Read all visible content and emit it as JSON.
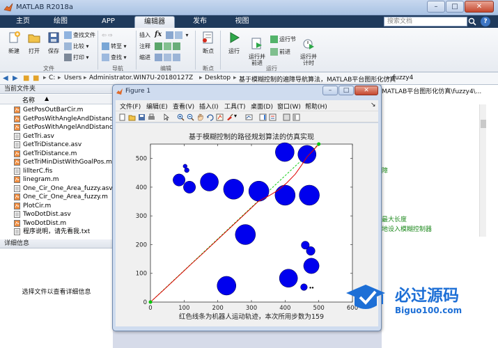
{
  "window": {
    "title": "MATLAB R2018a"
  },
  "tabs": [
    {
      "label": "主页",
      "active": false
    },
    {
      "label": "绘图",
      "active": false
    },
    {
      "label": "APP",
      "active": false
    },
    {
      "label": "编辑器",
      "active": true
    },
    {
      "label": "发布",
      "active": false
    },
    {
      "label": "视图",
      "active": false
    }
  ],
  "search": {
    "placeholder": "搜索文档"
  },
  "ribbon": {
    "file": {
      "new": "新建",
      "open": "打开",
      "save": "保存",
      "find_file": "查找文件",
      "compare": "比较",
      "print": "打印",
      "group": "文件"
    },
    "navigate": {
      "goto": "转至",
      "find": "查找",
      "group": "导航"
    },
    "edit": {
      "insert": "插入",
      "comment": "注释",
      "indent": "缩进",
      "fx": "fx",
      "group": "编辑"
    },
    "breakpoints": {
      "bp": "断点",
      "group": "断点"
    },
    "run": {
      "run": "运行",
      "run_advance": "运行并\n前进",
      "run_section": "运行节",
      "advance": "前进",
      "run_time": "运行并\n计时",
      "group": "运行"
    }
  },
  "address": {
    "crumbs": [
      "C:",
      "Users",
      "Administrator.WIN7U-20180127Z",
      "Desktop",
      "基于模糊控制的遍障导航算法，MATLAB平台图形化仿真",
      "fuzzy4"
    ]
  },
  "left_panel": {
    "header": "当前文件夹",
    "col_name": "名称",
    "files": [
      {
        "name": "GetPosOutBarCir.m",
        "type": "m"
      },
      {
        "name": "GetPosWithAngleAndDistance....",
        "type": "m"
      },
      {
        "name": "GetPosWithAngelAndDistance.m",
        "type": "m"
      },
      {
        "name": "GetTri.asv",
        "type": "asv"
      },
      {
        "name": "GetTriDistance.asv",
        "type": "asv"
      },
      {
        "name": "GetTriDistance.m",
        "type": "m"
      },
      {
        "name": "GetTriMinDistWithGoalPos.m",
        "type": "m"
      },
      {
        "name": "lillterC.fis",
        "type": "fis"
      },
      {
        "name": "linegram.m",
        "type": "m"
      },
      {
        "name": "One_Cir_One_Area_fuzzy.asv",
        "type": "asv"
      },
      {
        "name": "One_Cir_One_Area_fuzzy.m",
        "type": "m"
      },
      {
        "name": "PlotCir.m",
        "type": "m"
      },
      {
        "name": "TwoDotDist.asv",
        "type": "asv"
      },
      {
        "name": "TwoDotDist.m",
        "type": "m"
      },
      {
        "name": "程序说明，请先看我.txt",
        "type": "txt"
      }
    ],
    "details_header": "详细信息",
    "details_empty": "选择文件以查看详细信息"
  },
  "right_panel": {
    "path": "MATLAB平台图形化仿真\\fuzzy4\\...",
    "frag1": "障",
    "frag2": "最大长度",
    "frag3": "地设入模糊控制器"
  },
  "figure": {
    "title": "Figure 1",
    "menus": [
      "文件(F)",
      "编辑(E)",
      "查看(V)",
      "插入(I)",
      "工具(T)",
      "桌面(D)",
      "窗口(W)",
      "帮助(H)"
    ]
  },
  "chart_data": {
    "type": "scatter",
    "title": "基于模糊控制的路径规划算法的仿真实现",
    "xlabel_prefix": "红色线条为机器人运动轨迹，本次所用步数为",
    "steps": "159",
    "xlim": [
      0,
      600
    ],
    "ylim": [
      0,
      550
    ],
    "xticks": [
      0,
      100,
      200,
      300,
      400,
      500,
      600
    ],
    "yticks": [
      0,
      100,
      200,
      300,
      400,
      500
    ],
    "xtick_labels": [
      "0",
      "100",
      "200",
      "300",
      "400",
      "500",
      "600"
    ],
    "ytick_labels": [
      "0",
      "100",
      "200",
      "300",
      "400",
      "500"
    ],
    "obstacles": [
      {
        "x": 103,
        "y": 473,
        "r": 6
      },
      {
        "x": 108,
        "y": 459,
        "r": 7
      },
      {
        "x": 85,
        "y": 425,
        "r": 18
      },
      {
        "x": 116,
        "y": 400,
        "r": 18
      },
      {
        "x": 175,
        "y": 418,
        "r": 27
      },
      {
        "x": 247,
        "y": 393,
        "r": 30
      },
      {
        "x": 322,
        "y": 386,
        "r": 30
      },
      {
        "x": 400,
        "y": 372,
        "r": 30
      },
      {
        "x": 472,
        "y": 372,
        "r": 30
      },
      {
        "x": 399,
        "y": 522,
        "r": 28
      },
      {
        "x": 465,
        "y": 514,
        "r": 27
      },
      {
        "x": 282,
        "y": 235,
        "r": 30
      },
      {
        "x": 460,
        "y": 198,
        "r": 12
      },
      {
        "x": 476,
        "y": 178,
        "r": 13
      },
      {
        "x": 478,
        "y": 126,
        "r": 23
      },
      {
        "x": 226,
        "y": 57,
        "r": 28
      },
      {
        "x": 410,
        "y": 83,
        "r": 27
      },
      {
        "x": 456,
        "y": 52,
        "r": 10
      }
    ],
    "small_marks": [
      {
        "x": 475,
        "y": 50
      },
      {
        "x": 482,
        "y": 50
      }
    ],
    "start": {
      "x": 0,
      "y": 0
    },
    "goal": {
      "x": 500,
      "y": 550
    },
    "robot_path": [
      [
        0,
        0
      ],
      [
        40,
        43
      ],
      [
        80,
        87
      ],
      [
        120,
        131
      ],
      [
        160,
        174
      ],
      [
        200,
        218
      ],
      [
        240,
        262
      ],
      [
        280,
        306
      ],
      [
        320,
        350
      ],
      [
        355,
        372
      ],
      [
        380,
        390
      ],
      [
        405,
        415
      ],
      [
        430,
        445
      ],
      [
        448,
        475
      ],
      [
        465,
        505
      ],
      [
        485,
        530
      ],
      [
        500,
        550
      ]
    ],
    "colors": {
      "obstacle": "#0000ee",
      "path": "#e00000",
      "reference": "#00c800"
    }
  },
  "watermark": {
    "text": "必过源码",
    "url": "Biguo100.com"
  }
}
